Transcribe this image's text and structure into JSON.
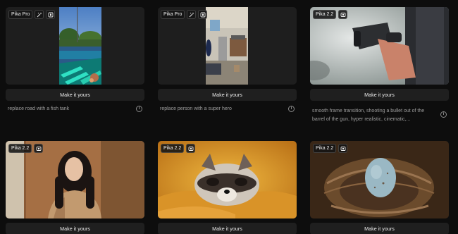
{
  "cards": [
    {
      "model": "Pika Pro",
      "button": "Make it yours",
      "prompt": "replace road with a fish tank",
      "info": "i"
    },
    {
      "model": "Pika Pro",
      "button": "Make it yours",
      "prompt": "replace person with a super hero",
      "info": "i"
    },
    {
      "model": "Pika 2.2",
      "button": "Make it yours",
      "prompt": "smooth frame transition, shooting a bullet out of the barrel of the gun, hyper realistic, cinematic,...",
      "info": "i"
    },
    {
      "model": "Pika 2.2",
      "button": "Make it yours"
    },
    {
      "model": "Pika 2.2",
      "button": "Make it yours"
    },
    {
      "model": "Pika 2.2",
      "button": "Make it yours"
    }
  ],
  "icons": {
    "magic": "magic-wand-icon",
    "frame": "frame-icon",
    "image": "image-icon",
    "info": "info-icon"
  },
  "colors": {
    "background": "#0d0d0d",
    "card": "#1e1e1e",
    "button": "#1f1f1f",
    "text": "#ececec",
    "muted": "#9f9f9f"
  }
}
